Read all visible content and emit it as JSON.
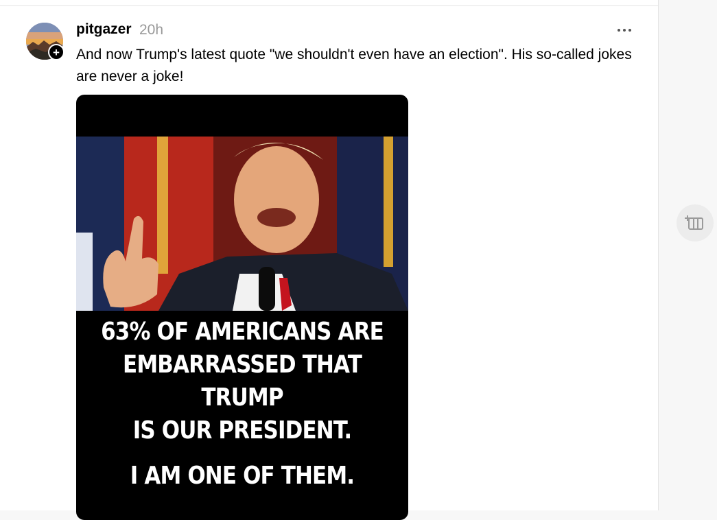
{
  "post": {
    "username": "pitgazer",
    "timestamp": "20h",
    "more_icon": "more-horizontal-icon",
    "follow_icon": "plus-icon",
    "text": "And now Trump's latest quote \"we shouldn't even have an election\". His so-called jokes are never a joke!",
    "image": {
      "caption_lines": [
        "63% OF AMERICANS ARE",
        "EMBARRASSED THAT TRUMP",
        "IS OUR PRESIDENT.",
        "I AM ONE OF THEM."
      ]
    }
  },
  "side_action": {
    "icon": "add-column-icon"
  },
  "colors": {
    "text": "#000000",
    "muted": "#999999",
    "border": "#e3e3e3",
    "image_bg": "#000000"
  }
}
